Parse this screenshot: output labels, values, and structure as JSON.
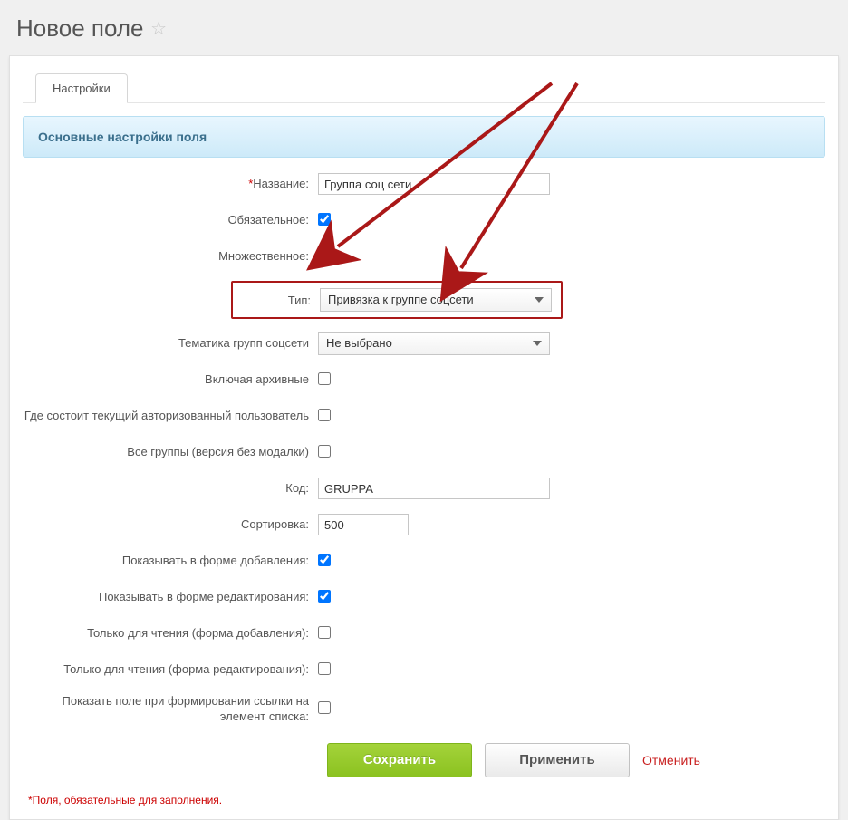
{
  "page": {
    "title": "Новое поле"
  },
  "tabs": {
    "settings": "Настройки"
  },
  "section": {
    "title": "Основные настройки поля"
  },
  "fields": {
    "name_label": "Название:",
    "name_value": "Группа соц сети",
    "mandatory_label": "Обязательное:",
    "mandatory_checked": true,
    "multiple_label": "Множественное:",
    "multiple_checked": true,
    "type_label": "Тип:",
    "type_value": "Привязка к группе соцсети",
    "topic_label": "Тематика групп соцсети",
    "topic_value": "Не выбрано",
    "archive_label": "Включая архивные",
    "archive_checked": false,
    "member_label": "Где состоит текущий авторизованный пользователь",
    "member_checked": false,
    "allgroups_label": "Все группы (версия без модалки)",
    "allgroups_checked": false,
    "code_label": "Код:",
    "code_value": "GRUPPA",
    "sort_label": "Сортировка:",
    "sort_value": "500",
    "show_add_label": "Показывать в форме добавления:",
    "show_add_checked": true,
    "show_edit_label": "Показывать в форме редактирования:",
    "show_edit_checked": true,
    "ro_add_label": "Только для чтения (форма добавления):",
    "ro_add_checked": false,
    "ro_edit_label": "Только для чтения (форма редактирования):",
    "ro_edit_checked": false,
    "show_link_label": "Показать поле при формировании ссылки на элемент списка:",
    "show_link_checked": false
  },
  "buttons": {
    "save": "Сохранить",
    "apply": "Применить",
    "cancel": "Отменить"
  },
  "footnote": {
    "required_text": "Поля, обязательные для заполнения."
  }
}
